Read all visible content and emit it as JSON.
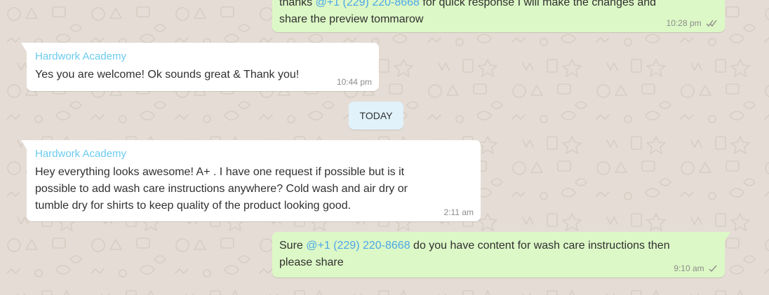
{
  "messages": [
    {
      "direction": "outgoing",
      "line1_pre": "thanks ",
      "line1_mention": "@+1 (229) 220-8668",
      "line1_post": " for quick response I will make the changes and",
      "line2": "share the preview tommarow",
      "time": "10:28 pm",
      "status": "double-check-icon"
    },
    {
      "direction": "incoming",
      "sender": "Hardwork Academy",
      "text": "Yes you are welcome! Ok sounds great & Thank you!",
      "time": "10:44 pm"
    },
    {
      "direction": "incoming",
      "sender": "Hardwork Academy",
      "lines": [
        "Hey everything looks awesome! A+ . I have one request if possible but is it",
        "possible to add wash care instructions anywhere? Cold wash and air dry or",
        "tumble dry for shirts to keep quality of the product looking good."
      ],
      "time": "2:11 am"
    },
    {
      "direction": "outgoing",
      "line1_pre": "Sure ",
      "line1_mention": "@+1 (229) 220-8668",
      "line1_post": " do you have content for wash care instructions then",
      "line2": "please share",
      "time": "9:10 am",
      "status": "single-check-icon"
    }
  ],
  "day_divider": "TODAY",
  "colors": {
    "background": "#e5ddd5",
    "incoming_bubble": "#ffffff",
    "outgoing_bubble": "#dcf8c6",
    "sender_name": "#6bcbef",
    "mention": "#4ca7e8",
    "day_chip": "#e1f2fb"
  }
}
